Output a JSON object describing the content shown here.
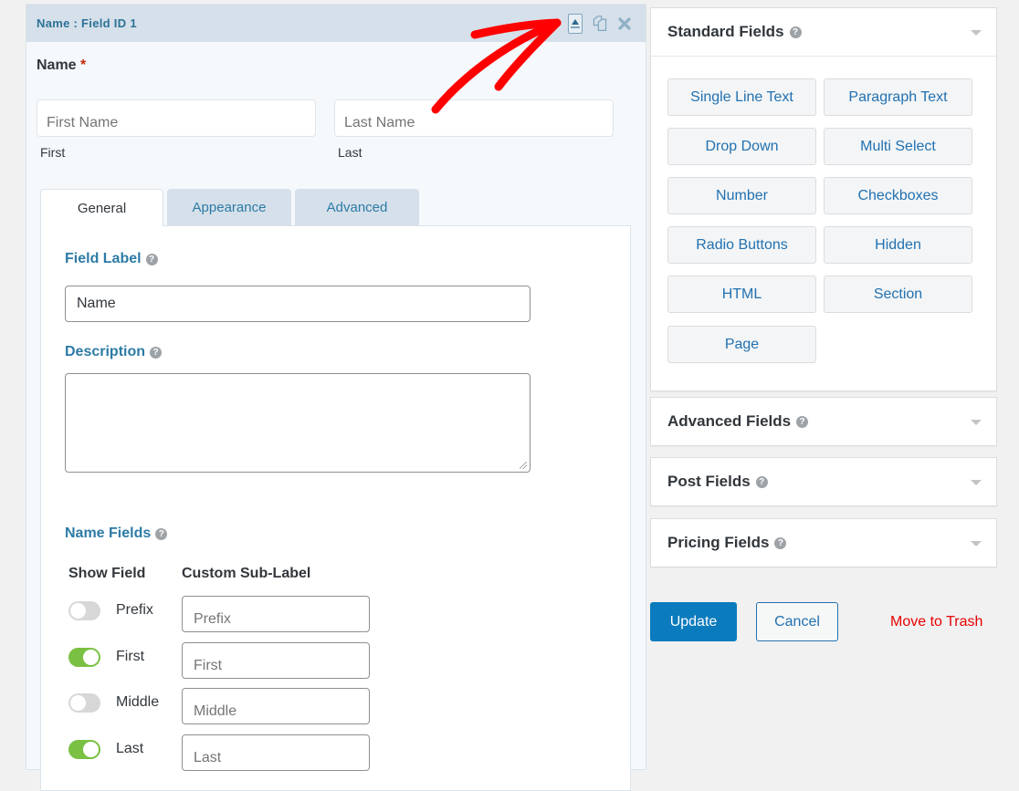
{
  "field_editor": {
    "title": "Name : Field ID 1",
    "actions": {
      "collapse": "collapse-icon",
      "duplicate": "duplicate-icon",
      "delete": "close-icon"
    },
    "preview": {
      "label": "Name",
      "required_marker": "*",
      "first_placeholder": "First Name",
      "last_placeholder": "Last Name",
      "first_sublabel": "First",
      "last_sublabel": "Last"
    },
    "tabs": [
      {
        "label": "General",
        "active": true
      },
      {
        "label": "Appearance",
        "active": false
      },
      {
        "label": "Advanced",
        "active": false
      }
    ],
    "general": {
      "field_label_title": "Field Label",
      "field_label_value": "Name",
      "description_title": "Description",
      "description_value": "",
      "name_fields_title": "Name Fields",
      "col_show_field": "Show Field",
      "col_custom_sublabel": "Custom Sub-Label",
      "name_fields": [
        {
          "label": "Prefix",
          "enabled": false,
          "placeholder": "Prefix"
        },
        {
          "label": "First",
          "enabled": true,
          "placeholder": "First"
        },
        {
          "label": "Middle",
          "enabled": false,
          "placeholder": "Middle"
        },
        {
          "label": "Last",
          "enabled": true,
          "placeholder": "Last"
        }
      ]
    }
  },
  "sidebar": {
    "standard_fields": {
      "title": "Standard Fields",
      "buttons": [
        "Single Line Text",
        "Paragraph Text",
        "Drop Down",
        "Multi Select",
        "Number",
        "Checkboxes",
        "Radio Buttons",
        "Hidden",
        "HTML",
        "Section",
        "Page"
      ]
    },
    "collapsed_groups": [
      "Advanced Fields",
      "Post Fields",
      "Pricing Fields"
    ],
    "help_glyph": "?",
    "update_label": "Update",
    "cancel_label": "Cancel",
    "trash_label": "Move to Trash"
  },
  "colors": {
    "accent_blue": "#2271b1",
    "update_blue": "#0a7bbd",
    "toggle_on": "#7ac143",
    "trash_red": "#e60000",
    "annotation_red": "#ff0000"
  }
}
